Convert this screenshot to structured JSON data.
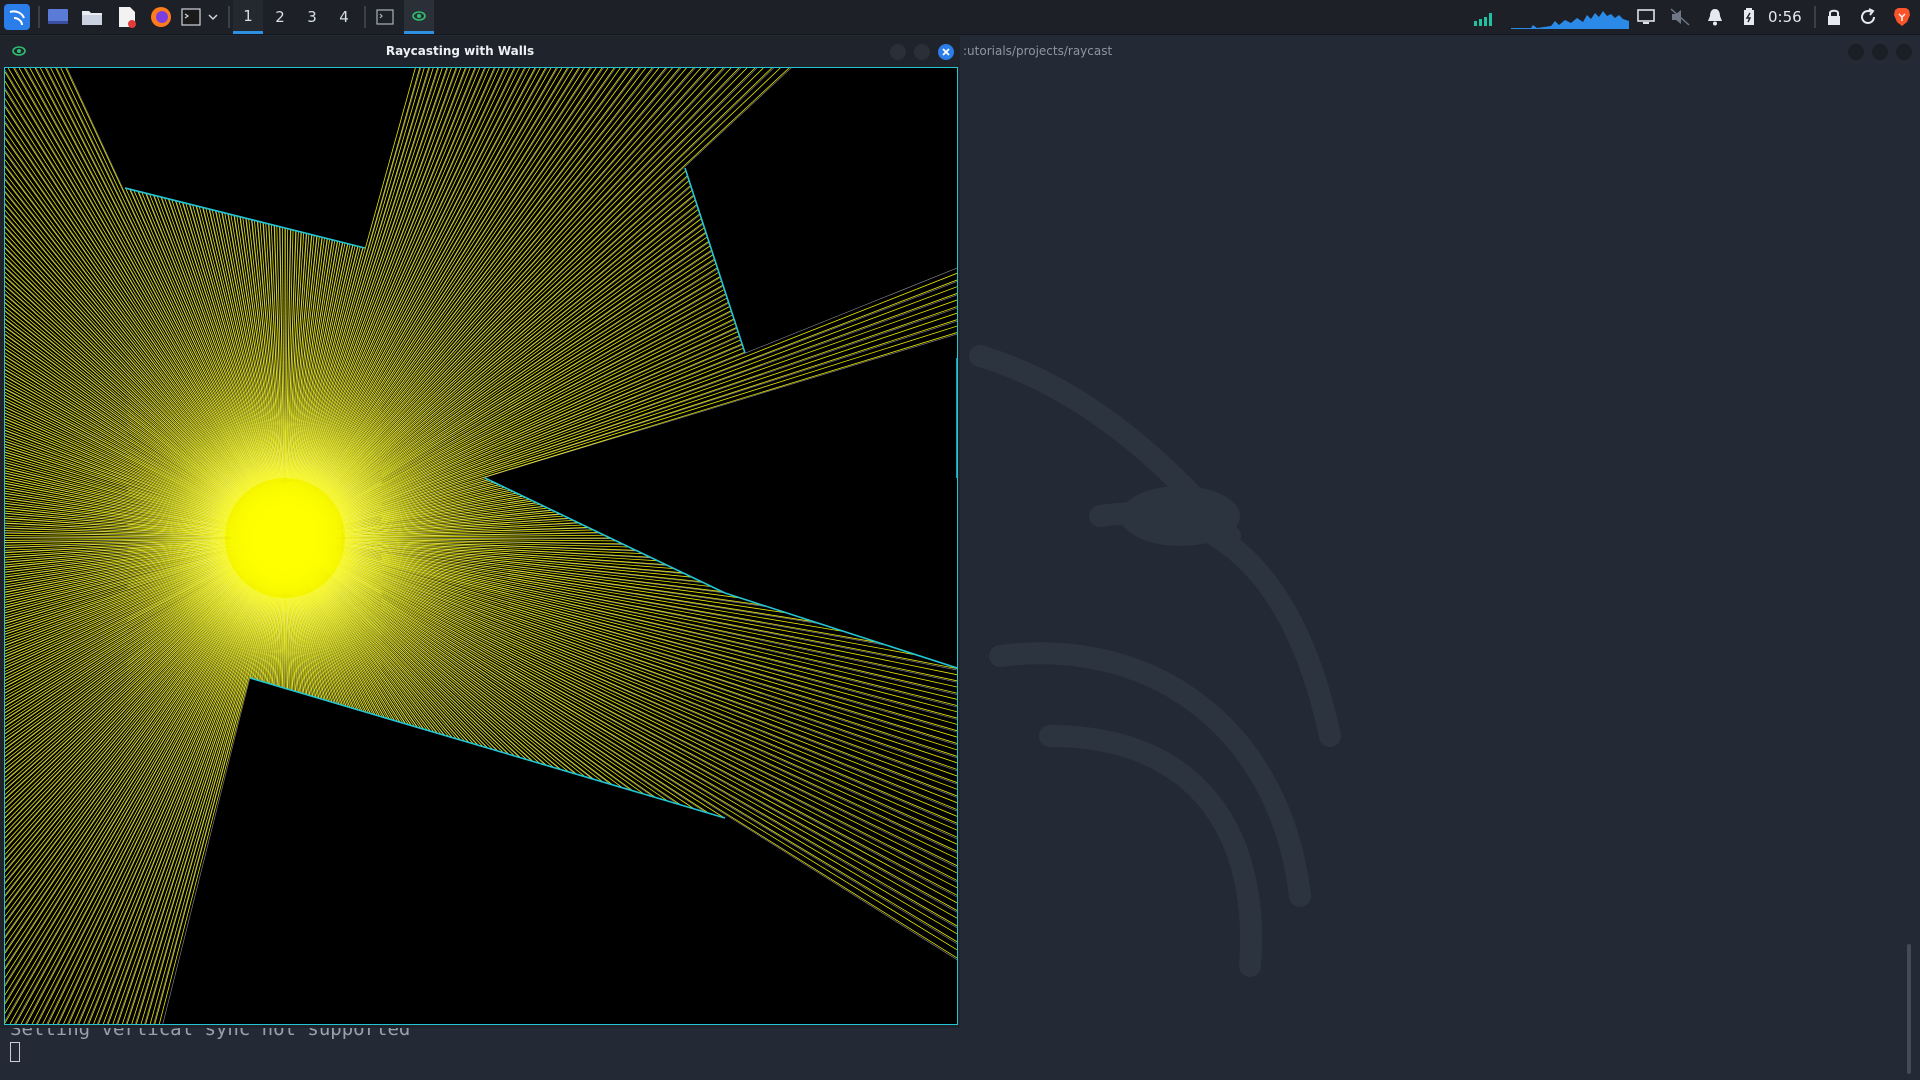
{
  "panel": {
    "workspaces": [
      {
        "label": "1",
        "active": true
      },
      {
        "label": "2",
        "active": false
      },
      {
        "label": "3",
        "active": false
      },
      {
        "label": "4",
        "active": false
      }
    ],
    "clock": "0:56",
    "icons": [
      "kali-menu-icon",
      "show-desktop-icon",
      "file-manager-icon",
      "text-editor-icon",
      "firefox-icon",
      "terminal-icon",
      "chevron-down-icon",
      "terminal-window-icon",
      "raycast-window-icon",
      "network-graph-icon",
      "cpu-graph-icon",
      "display-icon",
      "volume-muted-icon",
      "notification-bell-icon",
      "battery-icon",
      "lock-icon",
      "refresh-icon",
      "brave-icon"
    ]
  },
  "window": {
    "title": "Raycasting with Walls",
    "app_icon": "eye-icon",
    "border_color": "#22c5d4",
    "ray_color": "#ffff00",
    "wall_color": "#22c5d4",
    "source_color": "#ffff00"
  },
  "terminal": {
    "title": ":utorials/projects/raycast",
    "output_line": "Setting vertical sync not supported"
  }
}
